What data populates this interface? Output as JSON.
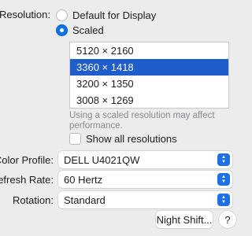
{
  "resolution": {
    "label": "Resolution:",
    "options": [
      {
        "label": "Default for Display",
        "selected": false
      },
      {
        "label": "Scaled",
        "selected": true
      }
    ],
    "list": [
      {
        "label": "5120 × 2160",
        "selected": false
      },
      {
        "label": "3360 × 1418",
        "selected": true
      },
      {
        "label": "3200 × 1350",
        "selected": false
      },
      {
        "label": "3008 × 1269",
        "selected": false
      }
    ],
    "hint": "Using a scaled resolution may affect performance.",
    "show_all": {
      "label": "Show all resolutions",
      "checked": false
    }
  },
  "color_profile": {
    "label": "Color Profile:",
    "value": "DELL U4021QW"
  },
  "refresh_rate": {
    "label": "Refresh Rate:",
    "value": "60 Hertz"
  },
  "rotation": {
    "label": "Rotation:",
    "value": "Standard"
  },
  "night_shift_button": "Night Shift...",
  "help_button": "?",
  "colors": {
    "accent": "#1f6fe5",
    "selection": "#1f5dcc"
  },
  "icons": {
    "stepper": "up-down-chevron-icon",
    "help": "question-mark-icon"
  }
}
